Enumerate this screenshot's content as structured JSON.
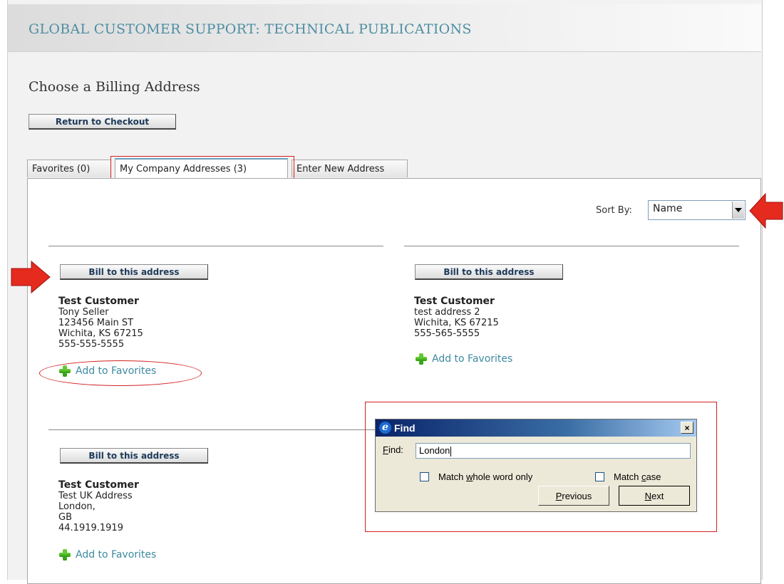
{
  "header": {
    "title": "GLOBAL CUSTOMER SUPPORT: TECHNICAL PUBLICATIONS"
  },
  "page": {
    "heading": "Choose a Billing Address",
    "return_label": "Return to Checkout"
  },
  "tabs": [
    {
      "label": "Favorites (0)"
    },
    {
      "label": "My Company Addresses (3)"
    },
    {
      "label": "Enter New Address"
    }
  ],
  "sort": {
    "label": "Sort By:",
    "value": "Name"
  },
  "addresses": [
    {
      "button": "Bill to this address",
      "name": "Test Customer",
      "lines": [
        "Tony Seller",
        "123456 Main ST",
        "Wichita, KS  67215",
        "555-555-5555"
      ],
      "favorite": "Add to Favorites"
    },
    {
      "button": "Bill to this address",
      "name": "Test Customer",
      "lines": [
        "test address 2",
        "Wichita, KS  67215",
        "555-565-5555"
      ],
      "favorite": "Add to Favorites"
    },
    {
      "button": "Bill to this address",
      "name": "Test Customer",
      "lines": [
        "Test UK Address",
        "London,",
        "GB",
        "44.1919.1919"
      ],
      "favorite": "Add to Favorites"
    }
  ],
  "find": {
    "title": "Find",
    "find_label_prefix": "",
    "find_label_accel": "F",
    "find_label_rest": "ind:",
    "value": "London",
    "whole_word_pre": "Match ",
    "whole_word_accel": "w",
    "whole_word_post": "hole word only",
    "case_pre": "Match ",
    "case_accel": "c",
    "case_post": "ase",
    "previous_accel": "P",
    "previous_rest": "revious",
    "next_accel": "N",
    "next_rest": "ext",
    "close": "×"
  },
  "colors": {
    "accent": "#4e8ea2",
    "link": "#3d8aa0",
    "annotation": "#d42020"
  }
}
